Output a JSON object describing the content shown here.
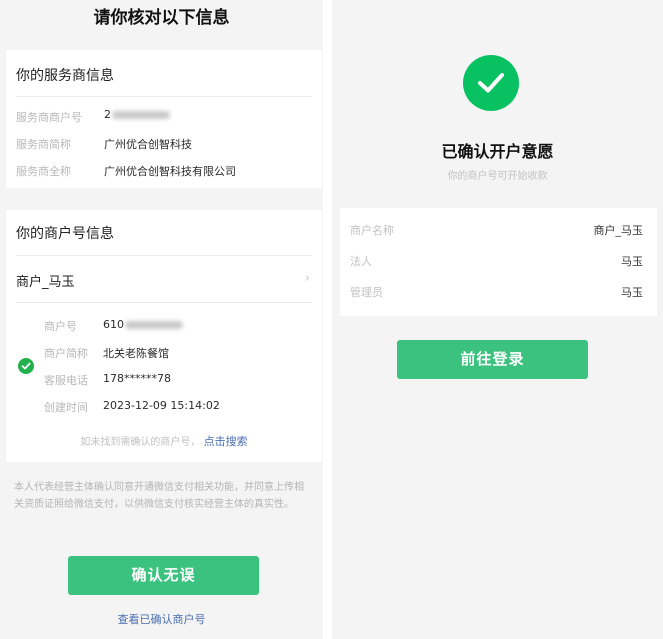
{
  "left": {
    "title": "请你核对以下信息",
    "provider": {
      "section_title": "你的服务商信息",
      "rows": [
        {
          "label": "服务商商户号",
          "value": "2"
        },
        {
          "label": "服务商简称",
          "value": "广州优合创智科技"
        },
        {
          "label": "服务商全称",
          "value": "广州优合创智科技有限公司"
        }
      ]
    },
    "merchant": {
      "section_title": "你的商户号信息",
      "merchant_name": "商户_马玉",
      "chevron": "›",
      "rows": [
        {
          "label": "商户号",
          "value": "610"
        },
        {
          "label": "商户简称",
          "value": "北关老陈餐馆"
        },
        {
          "label": "客服电话",
          "value": "178******78"
        },
        {
          "label": "创建时间",
          "value": "2023-12-09 15:14:02"
        }
      ],
      "hint_text": "如未找到需确认的商户号，",
      "hint_link": "点击搜索"
    },
    "consent_text": "本人代表经营主体确认同意开通微信支付相关功能，并同意上传相关资质证照给微信支付，以供微信支付核实经营主体的真实性。",
    "confirm_button": "确认无误",
    "view_confirmed_link": "查看已确认商户号"
  },
  "right": {
    "title": "已确认开户意愿",
    "subtitle": "你的商户号可开始收款",
    "rows": [
      {
        "label": "商户名称",
        "value": "商户_马玉"
      },
      {
        "label": "法人",
        "value": "马玉"
      },
      {
        "label": "管理员",
        "value": "马玉"
      }
    ],
    "login_button": "前往登录"
  },
  "colors": {
    "accent_green": "#3bc27f",
    "success_green": "#08c160",
    "link_blue": "#4a6fb0",
    "background": "#f4f4f4"
  },
  "icons": {
    "success": "check-circle-icon",
    "chevron": "chevron-right-icon",
    "selected": "check-circle-icon"
  }
}
